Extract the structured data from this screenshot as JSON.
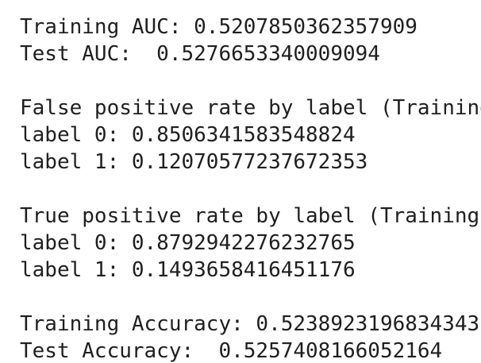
{
  "output": {
    "lines": [
      "Training AUC: 0.5207850362357909",
      "Test AUC:  0.5276653340009094",
      "",
      "False positive rate by label (Training",
      "label 0: 0.8506341583548824",
      "label 1: 0.12070577237672353",
      "",
      "True positive rate by label (Training",
      "label 0: 0.8792942276232765",
      "label 1: 0.1493658416451176",
      "",
      "Training Accuracy: 0.5238923196834343",
      "Test Accuracy:  0.5257408166052164"
    ]
  }
}
